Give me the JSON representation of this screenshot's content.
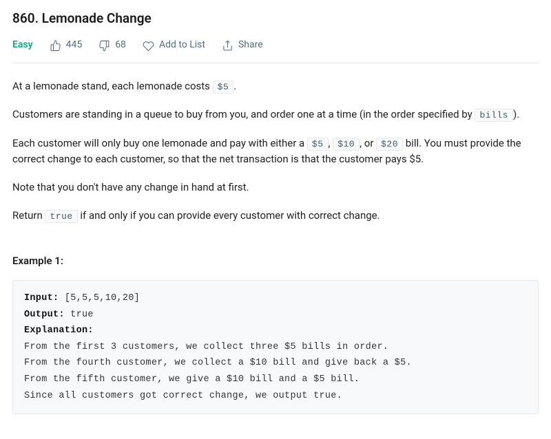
{
  "title": "860. Lemonade Change",
  "difficulty": "Easy",
  "upvotes": "445",
  "downvotes": "68",
  "add_to_list": "Add to List",
  "share": "Share",
  "paragraphs": {
    "p1_a": "At a lemonade stand, each lemonade costs ",
    "p1_code1": "$5",
    "p1_b": ".",
    "p2_a": "Customers are standing in a queue to buy from you, and order one at a time (in the order specified by ",
    "p2_code1": "bills",
    "p2_b": ").",
    "p3_a": "Each customer will only buy one lemonade and pay with either a ",
    "p3_code1": "$5",
    "p3_b": ", ",
    "p3_code2": "$10",
    "p3_c": ", or ",
    "p3_code3": "$20",
    "p3_d": " bill.  You must provide the correct change to each customer, so that the net transaction is that the customer pays $5.",
    "p4": "Note that you don't have any change in hand at first.",
    "p5_a": "Return ",
    "p5_code1": "true",
    "p5_b": " if and only if you can provide every customer with correct change."
  },
  "example": {
    "heading": "Example 1:",
    "input_label": "Input:",
    "input_value": " [5,5,5,10,20]",
    "output_label": "Output:",
    "output_value": " true",
    "explanation_label": "Explanation:",
    "lines": [
      "From the first 3 customers, we collect three $5 bills in order.",
      "From the fourth customer, we collect a $10 bill and give back a $5.",
      "From the fifth customer, we give a $10 bill and a $5 bill.",
      "Since all customers got correct change, we output true."
    ]
  }
}
